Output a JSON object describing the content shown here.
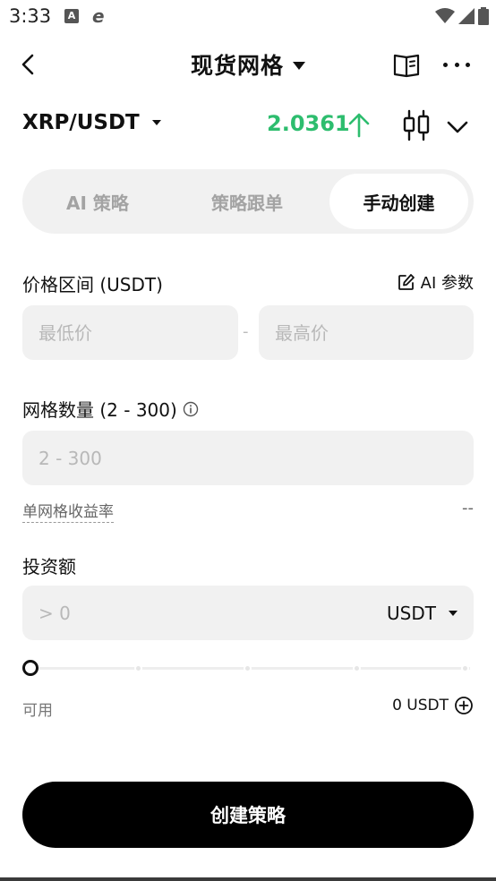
{
  "status_bar": {
    "time": "3:33",
    "icons": [
      "a-box-icon",
      "e-refresh-icon",
      "wifi-icon",
      "signal-icon",
      "battery-icon"
    ]
  },
  "header": {
    "title": "现货网格",
    "icons": [
      "back-arrow-icon",
      "book-icon",
      "more-icon"
    ]
  },
  "pair": {
    "name": "XRP/USDT",
    "price": "2.0361",
    "trend": "up",
    "price_color": "#2dbd6e"
  },
  "tabs": [
    {
      "label": "AI 策略",
      "active": false
    },
    {
      "label": "策略跟单",
      "active": false
    },
    {
      "label": "手动创建",
      "active": true
    }
  ],
  "price_range": {
    "label": "价格区间 (USDT)",
    "ai_param_label": "AI 参数",
    "min_placeholder": "最低价",
    "max_placeholder": "最高价",
    "separator": "-"
  },
  "grid": {
    "label": "网格数量 (2 - 300)",
    "placeholder": "2 - 300"
  },
  "yield": {
    "label": "单网格收益率",
    "value": "--"
  },
  "investment": {
    "label": "投资额",
    "placeholder": "> 0",
    "currency": "USDT",
    "slider_fraction": 0
  },
  "available": {
    "label": "可用",
    "value": "0 USDT"
  },
  "submit": {
    "label": "创建策略"
  },
  "colors": {
    "accent": "#000000",
    "positive": "#2dbd6e",
    "field_bg": "#f1f1f1"
  }
}
